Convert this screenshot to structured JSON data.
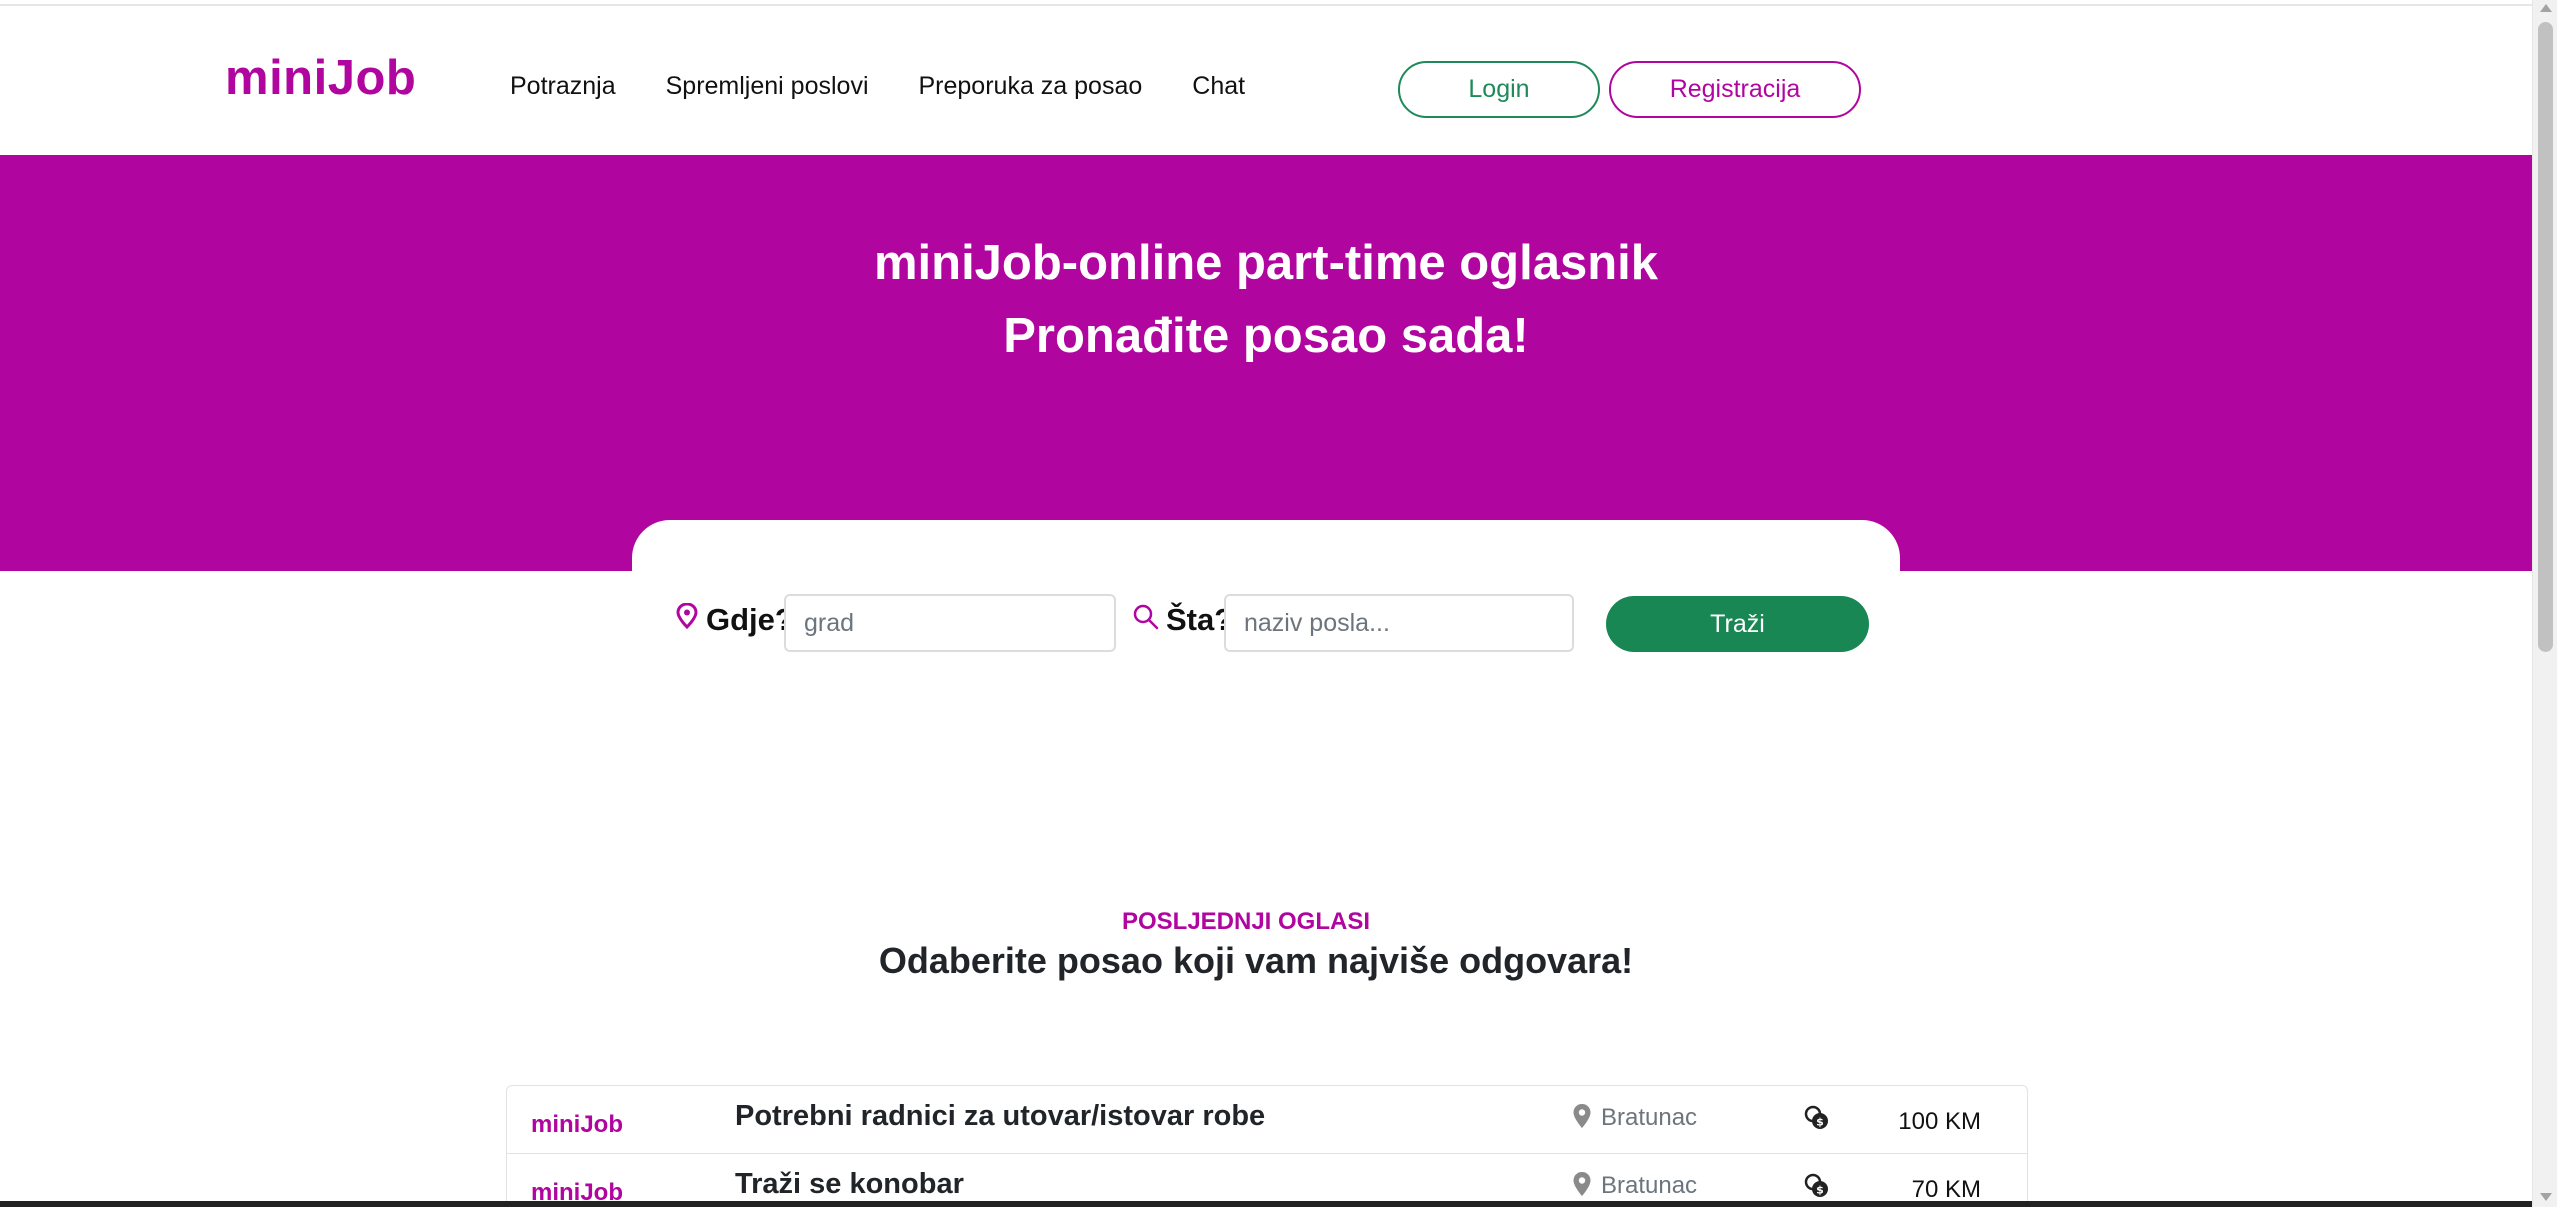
{
  "brand": {
    "name": "miniJob",
    "color": "#b0059f",
    "button_green": "#198754"
  },
  "nav": {
    "links": [
      "Potraznja",
      "Spremljeni poslovi",
      "Preporuka za posao",
      "Chat"
    ],
    "login_label": "Login",
    "register_label": "Registracija"
  },
  "hero": {
    "line1": "miniJob-online part-time oglasnik",
    "line2": "Pronađite posao sada!"
  },
  "search": {
    "where_label": "Gdje?",
    "where_placeholder": "grad",
    "what_label": "Šta?",
    "what_placeholder": "naziv posla...",
    "button_label": "Traži"
  },
  "section": {
    "eyebrow": "POSLJEDNJI OGLASI",
    "title": "Odaberite posao koji vam najviše odgovara!"
  },
  "jobs": [
    {
      "logo": "miniJob",
      "title": "Potrebni radnici za utovar/istovar robe",
      "city": "Bratunac",
      "pay": "100 KM"
    },
    {
      "logo": "miniJob",
      "title": "Traži se konobar",
      "city": "Bratunac",
      "pay": "70 KM"
    }
  ]
}
